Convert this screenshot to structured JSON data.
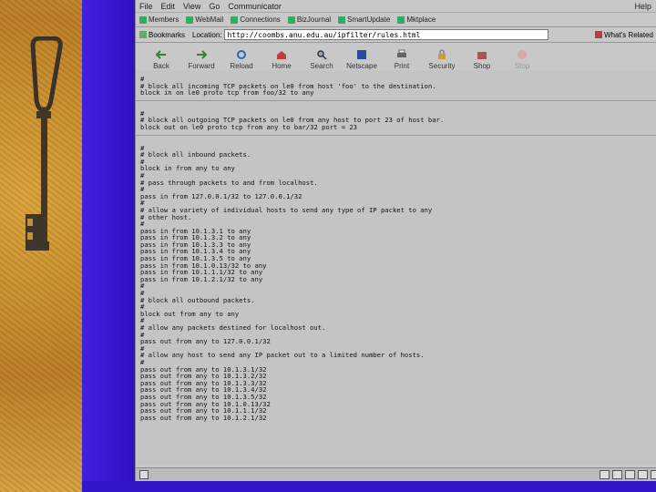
{
  "menu": [
    "File",
    "Edit",
    "View",
    "Go",
    "Communicator"
  ],
  "menu_help": "Help",
  "personal_toolbar": [
    "Members",
    "WebMail",
    "Connections",
    "BizJournal",
    "SmartUpdate",
    "Mktplace"
  ],
  "location": {
    "bookmarks": "Bookmarks",
    "label": "Location:",
    "url": "http://coombs.anu.edu.au/ipfilter/rules.html",
    "whats_related": "What's Related"
  },
  "toolbar": [
    "Back",
    "Forward",
    "Reload",
    "Home",
    "Search",
    "Netscape",
    "Print",
    "Security",
    "Shop",
    "Stop"
  ],
  "colors": {
    "blue_bar": "#3010c0",
    "window_bg": "#c8c8c8"
  },
  "content_sections": [
    [
      "#",
      "# block all incoming TCP packets on le0 from host 'foo' to the destination.",
      "block in on le0 proto tcp from foo/32 to any"
    ],
    [
      "#",
      "# block all outgoing TCP packets on le0 from any host to port 23 of host bar.",
      "block out on le0 proto tcp from any to bar/32 port = 23"
    ],
    [
      "#",
      "# block all inbound packets.",
      "#",
      "block in from any to any",
      "#",
      "# pass through packets to and from localhost.",
      "#",
      "pass in from 127.0.0.1/32 to 127.0.0.1/32",
      "#",
      "# allow a variety of individual hosts to send any type of IP packet to any",
      "# other host.",
      "#",
      "pass in from 10.1.3.1 to any",
      "pass in from 10.1.3.2 to any",
      "pass in from 10.1.3.3 to any",
      "pass in from 10.1.3.4 to any",
      "pass in from 10.1.3.5 to any",
      "pass in from 10.1.0.13/32 to any",
      "pass in from 10.1.1.1/32 to any",
      "pass in from 10.1.2.1/32 to any",
      "#",
      "#",
      "# block all outbound packets.",
      "#",
      "block out from any to any",
      "#",
      "# allow any packets destined for localhost out.",
      "#",
      "pass out from any to 127.0.0.1/32",
      "#",
      "# allow any host to send any IP packet out to a limited number of hosts.",
      "#",
      "pass out from any to 10.1.3.1/32",
      "pass out from any to 10.1.3.2/32",
      "pass out from any to 10.1.3.3/32",
      "pass out from any to 10.1.3.4/32",
      "pass out from any to 10.1.3.5/32",
      "pass out from any to 10.1.0.13/32",
      "pass out from any to 10.1.1.1/32",
      "pass out from any to 10.1.2.1/32"
    ]
  ]
}
